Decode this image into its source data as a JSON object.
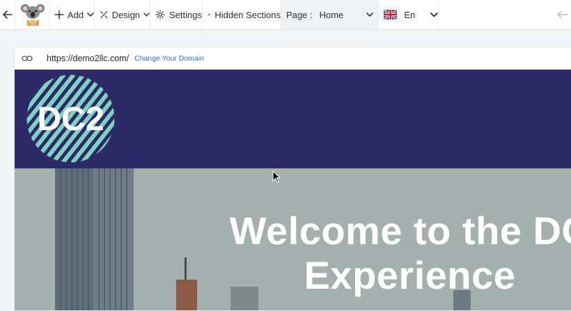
{
  "toolbar": {
    "add_label": "Add",
    "design_label": "Design",
    "settings_label": "Settings",
    "hidden_sections_label": "Hidden Sections",
    "page_label": "Page :",
    "page_value": "Home",
    "language_label": "En"
  },
  "icons": {
    "back": "arrow-left-icon",
    "logo": "koala-logo",
    "add": "plus-icon",
    "design": "paint-icon",
    "settings": "gear-icon",
    "hidden": "eye-slash-icon",
    "flag": "uk-flag-icon",
    "undo": "undo-icon",
    "link": "link-icon"
  },
  "urlbar": {
    "url": "https://demo2llc.com/",
    "change_domain_label": "Change Your Domain"
  },
  "site": {
    "logo_text": "DC2",
    "hero_title_line1": "Welcome to the DC",
    "hero_title_line2": "Experience"
  },
  "colors": {
    "header_bg": "#2d2a67",
    "logo_circle": "#7fd1c1",
    "link": "#2f6fd6",
    "toolbar_bg": "#ffffff",
    "page_dropdown_bg": "#f0f1f4"
  }
}
